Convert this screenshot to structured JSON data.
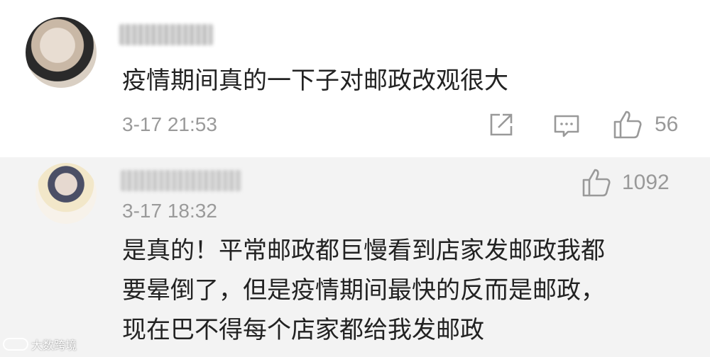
{
  "comments": [
    {
      "text": "疫情期间真的一下子对邮政改观很大",
      "timestamp": "3-17 21:53",
      "likes": "56"
    },
    {
      "timestamp": "3-17 18:32",
      "likes": "1092",
      "lines": [
        "是真的！平常邮政都巨慢看到店家发邮政我都",
        "要晕倒了，但是疫情期间最快的反而是邮政，",
        "现在巴不得每个店家都给我发邮政"
      ]
    }
  ],
  "watermark": {
    "text": "大数跨境"
  },
  "icons": {
    "share": "share-icon",
    "reply": "comment-icon",
    "like": "thumbs-up-icon"
  },
  "colors": {
    "background_primary": "#ffffff",
    "background_secondary": "#f3f3f3",
    "text": "#222222",
    "meta": "#9a9a9a"
  }
}
